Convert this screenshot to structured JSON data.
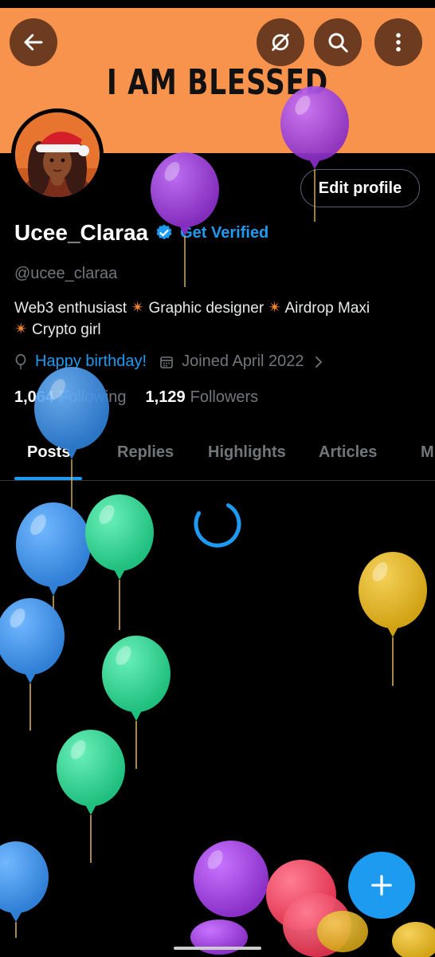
{
  "banner": {
    "text": "I AM BLESSED",
    "color": "#f7934c"
  },
  "top_bar": {
    "back_icon": "arrow-left-icon",
    "grok_icon": "slash-circle-icon",
    "search_icon": "search-icon",
    "more_icon": "more-vertical-icon"
  },
  "profile": {
    "display_name": "Ucee_Claraa",
    "get_verified_label": "Get Verified",
    "handle": "@ucee_claraa",
    "bio_line1_parts": [
      "Web3 enthusiast",
      "Graphic designer",
      "Airdrop Maxi"
    ],
    "bio_line2": "Crypto girl",
    "birthday_text": "Happy birthday!",
    "joined_text": "Joined April 2022",
    "following_count": "1,064",
    "following_label": "Following",
    "followers_count": "1,129",
    "followers_label": "Followers",
    "edit_profile_label": "Edit profile"
  },
  "tabs": [
    {
      "label": "Posts",
      "active": true
    },
    {
      "label": "Replies",
      "active": false
    },
    {
      "label": "Highlights",
      "active": false
    },
    {
      "label": "Articles",
      "active": false
    },
    {
      "label": "M",
      "active": false
    }
  ],
  "colors": {
    "accent": "#1d9bf0",
    "background": "#000000",
    "muted": "#71767b"
  },
  "fab_icon": "plus-icon",
  "balloon_colors": {
    "purple": "#9b3fd6",
    "blue": "#3a8fe0",
    "green": "#2ecc8f",
    "yellow": "#e0b21c",
    "red": "#e8445e"
  }
}
